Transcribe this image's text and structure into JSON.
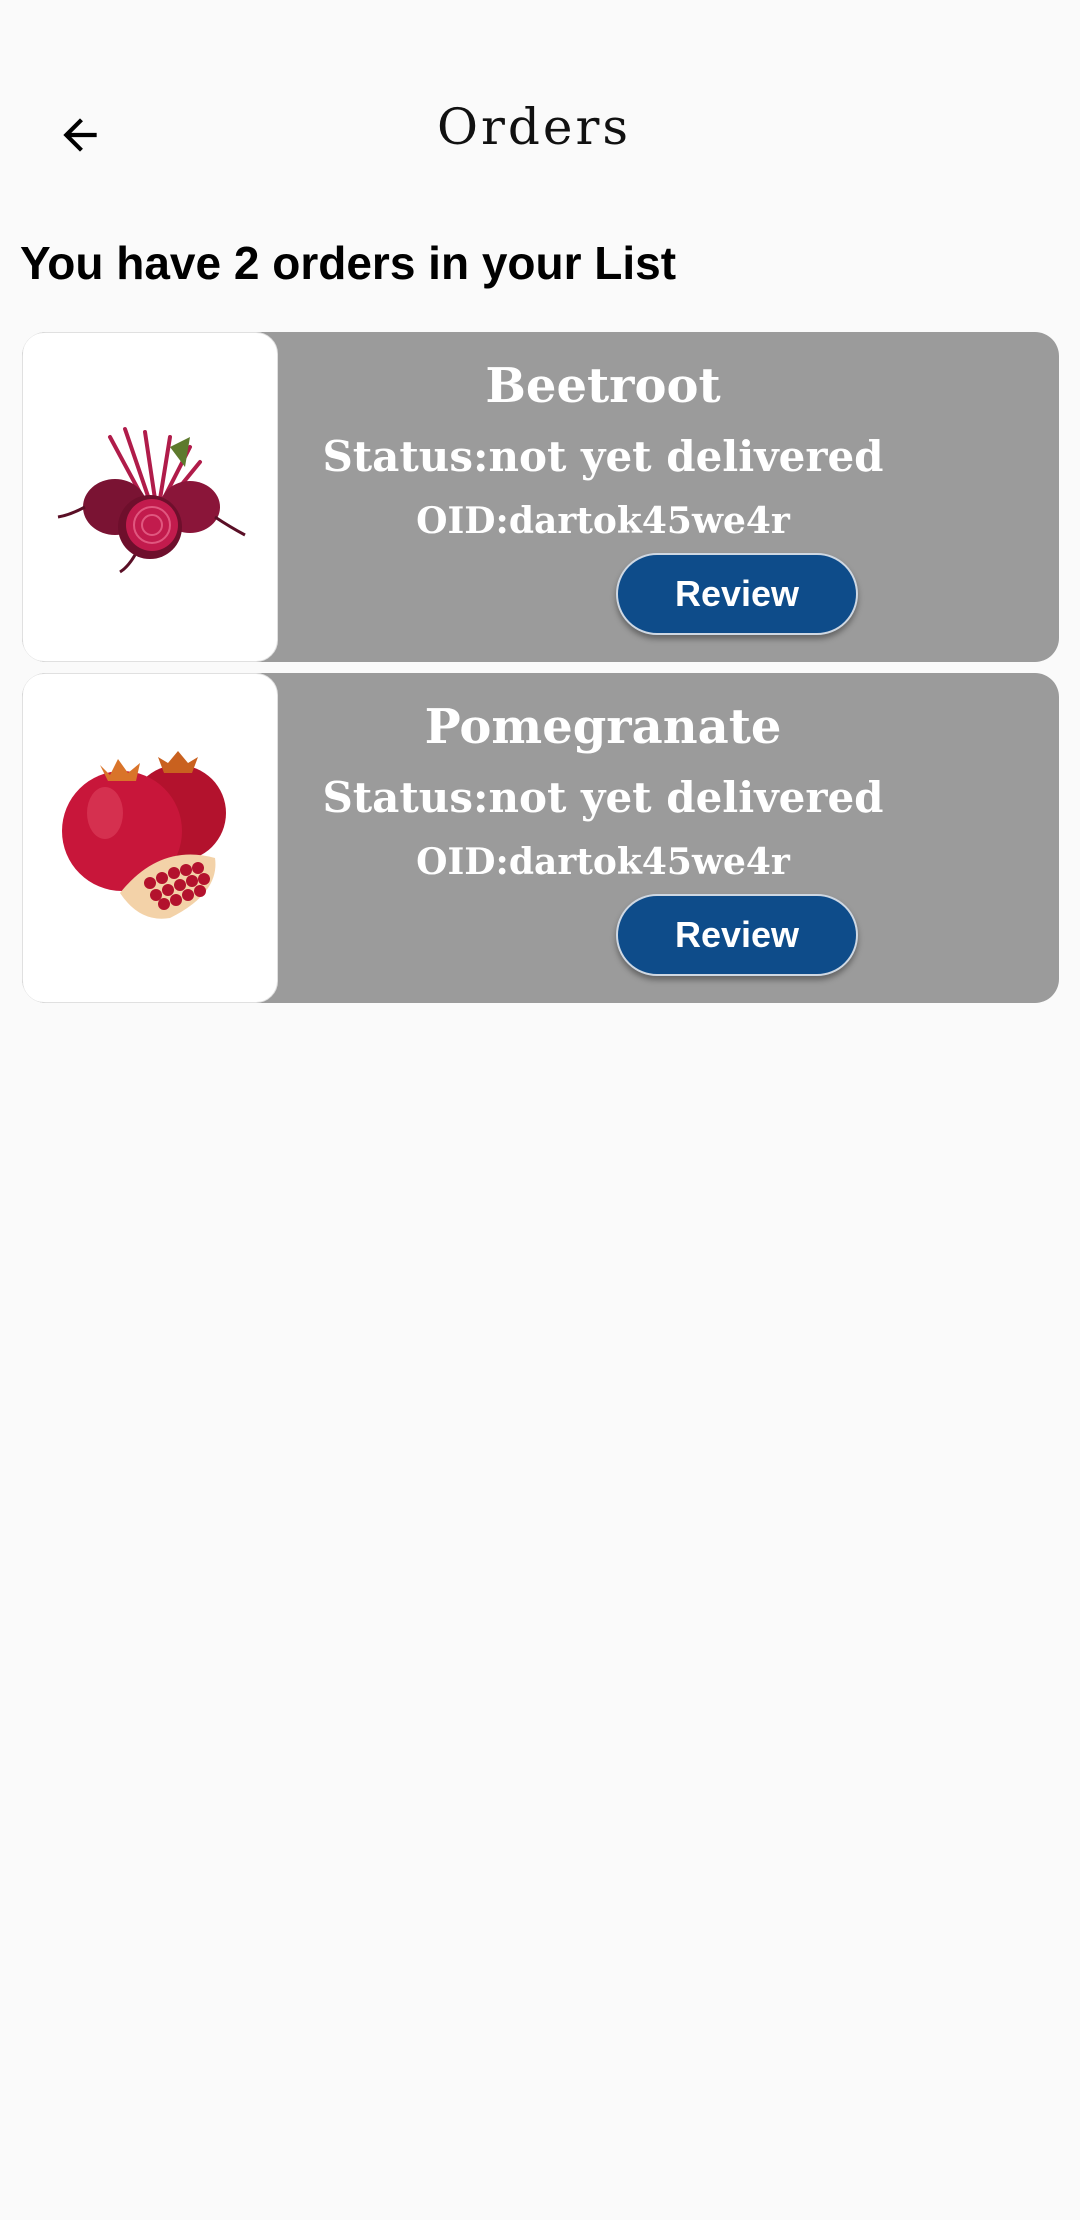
{
  "header": {
    "title": "Orders",
    "back_icon": "arrow-left-icon"
  },
  "summary": "You have 2 orders in your List",
  "orders": [
    {
      "name": "Beetroot",
      "status": "Status:not yet delivered",
      "oid": "OID:dartok45we4r",
      "review_label": "Review",
      "image_icon": "beetroot-image"
    },
    {
      "name": "Pomegranate",
      "status": "Status:not yet delivered",
      "oid": "OID:dartok45we4r",
      "review_label": "Review",
      "image_icon": "pomegranate-image"
    }
  ],
  "colors": {
    "background": "#fafafa",
    "card": "#9b9b9b",
    "button": "#0e4c8a",
    "card_text": "#ffffff"
  }
}
